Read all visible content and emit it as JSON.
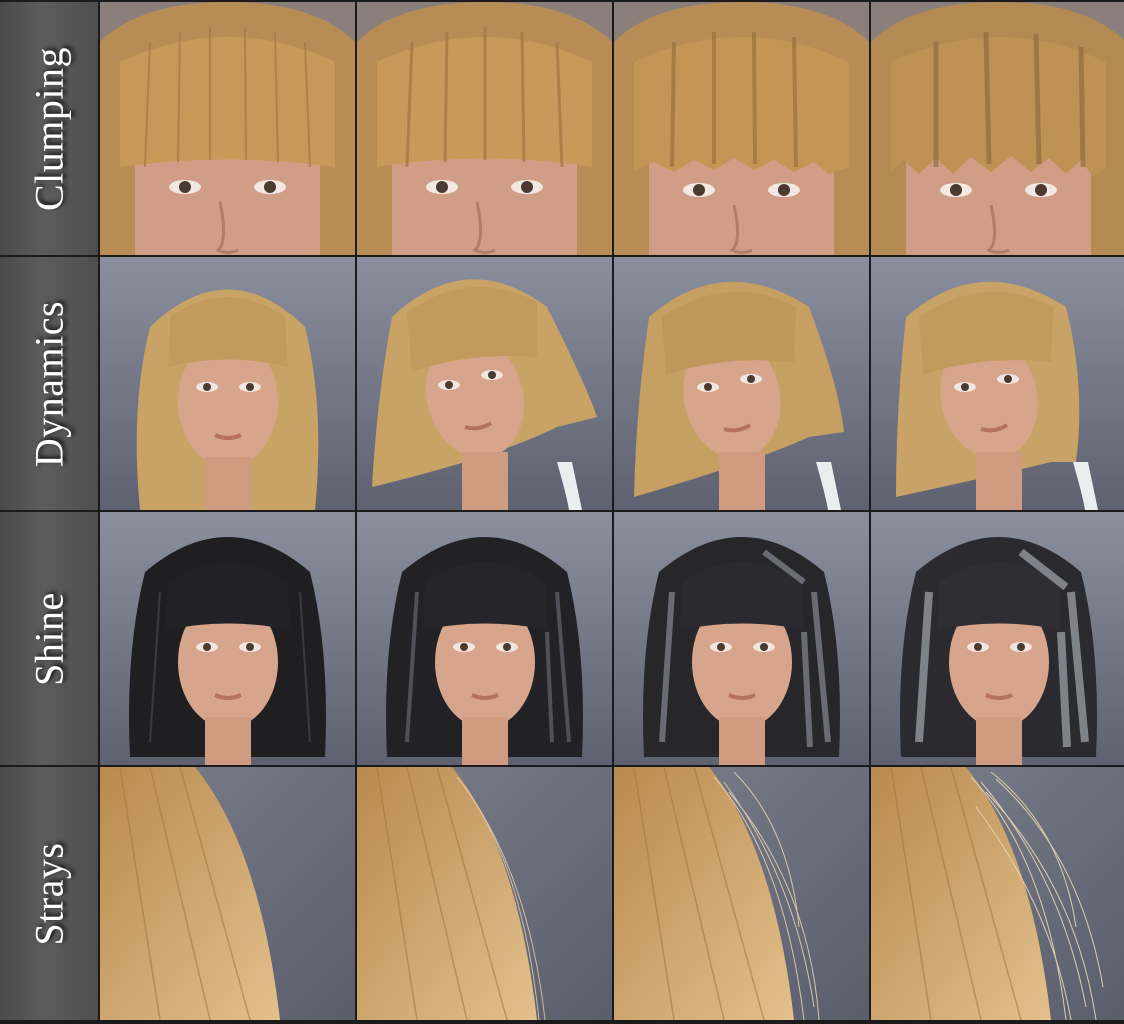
{
  "rows": [
    {
      "label": "Clumping",
      "hair_color": "#c79a5a"
    },
    {
      "label": "Dynamics",
      "hair_color": "#c9a266"
    },
    {
      "label": "Shine",
      "hair_color": "#1f1f22"
    },
    {
      "label": "Strays",
      "hair_color": "#d2a870"
    }
  ],
  "colors": {
    "background": "#6b6f7c",
    "skin": "#d6a58c",
    "dark_hair": "#1f1f22",
    "highlight_hair": "#9ca0a8"
  }
}
